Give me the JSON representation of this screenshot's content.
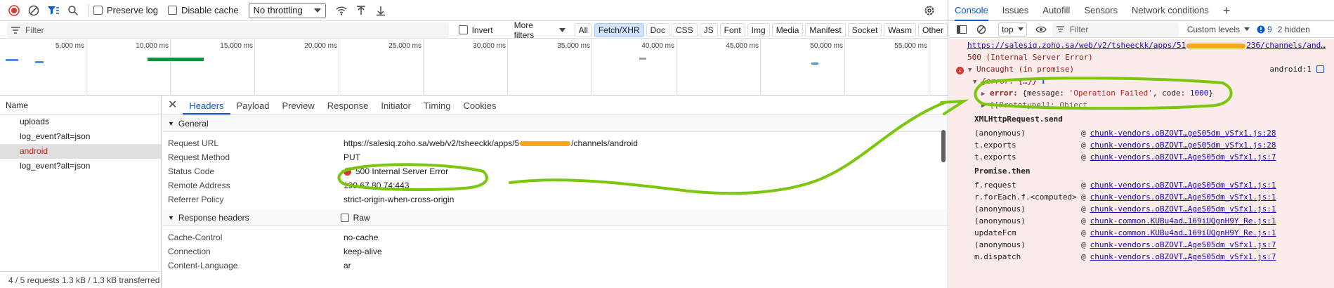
{
  "network": {
    "toolbar": {
      "preserve_log": "Preserve log",
      "disable_cache": "Disable cache",
      "throttling": "No throttling"
    },
    "filterbar": {
      "placeholder": "Filter",
      "invert": "Invert",
      "more_filters": "More filters",
      "types": [
        "All",
        "Fetch/XHR",
        "Doc",
        "CSS",
        "JS",
        "Font",
        "Img",
        "Media",
        "Manifest",
        "Socket",
        "Wasm",
        "Other"
      ],
      "active_type": "Fetch/XHR"
    },
    "overview": {
      "ticks": [
        "5,000 ms",
        "10,000 ms",
        "15,000 ms",
        "20,000 ms",
        "25,000 ms",
        "30,000 ms",
        "35,000 ms",
        "40,000 ms",
        "45,000 ms",
        "50,000 ms",
        "55,000 ms"
      ]
    },
    "requests": {
      "header": "Name",
      "items": [
        "uploads",
        "log_event?alt=json",
        "android",
        "log_event?alt=json"
      ],
      "selected": "android"
    },
    "status": "4 / 5 requests   1.3 kB / 1.3 kB transferred",
    "details": {
      "tabs": [
        "Headers",
        "Payload",
        "Preview",
        "Response",
        "Initiator",
        "Timing",
        "Cookies"
      ],
      "general": {
        "title": "General",
        "request_url_key": "Request URL",
        "request_url_a": "https://salesiq.zoho.sa/web/v2/tsheeckk/apps/5",
        "request_url_b": "/channels/android",
        "method_key": "Request Method",
        "method_val": "PUT",
        "status_key": "Status Code",
        "status_val": "500 Internal Server Error",
        "remote_key": "Remote Address",
        "remote_val": "199.67.80.74:443",
        "referrer_key": "Referrer Policy",
        "referrer_val": "strict-origin-when-cross-origin"
      },
      "response": {
        "title": "Response headers",
        "raw": "Raw",
        "rows": [
          {
            "key": "Cache-Control",
            "val": "no-cache"
          },
          {
            "key": "Connection",
            "val": "keep-alive"
          },
          {
            "key": "Content-Language",
            "val": "ar"
          }
        ]
      }
    }
  },
  "console": {
    "tabs": [
      "Console",
      "Issues",
      "Autofill",
      "Sensors",
      "Network conditions"
    ],
    "context": "top",
    "filter_placeholder": "Filter",
    "levels": "Custom levels",
    "issues_count": "9",
    "hidden": "2 hidden",
    "lines": {
      "url_a": "https://salesiq.zoho.sa/web/v2/tsheeckk/apps/51",
      "url_b": "236/channels/and…",
      "http_status": "500 (Internal Server Error)",
      "uncaught": "Uncaught (in promise)",
      "uncaught_src": "android:1",
      "obj_open": "{error: {…}}",
      "error_key": "error:",
      "error_msg": "'Operation Failed'",
      "error_code": "1000",
      "proto": "[[Prototype]]: Object",
      "xhr_send": "XMLHttpRequest.send",
      "promise_then": "Promise.then"
    },
    "stack1": [
      {
        "fn": "(anonymous)",
        "src": "chunk-vendors.oBZOVT…geS05dm_vSfx1.js:28"
      },
      {
        "fn": "t.exports",
        "src": "chunk-vendors.oBZOVT…geS05dm_vSfx1.js:28"
      },
      {
        "fn": "t.exports",
        "src": "chunk-vendors.oBZOVT…AgeS05dm_vSfx1.js:7"
      }
    ],
    "stack2": [
      {
        "fn": "f.request",
        "src": "chunk-vendors.oBZOVT…AgeS05dm_vSfx1.js:1"
      },
      {
        "fn": "r.forEach.f.<computed>",
        "src": "chunk-vendors.oBZOVT…AgeS05dm_vSfx1.js:1"
      },
      {
        "fn": "(anonymous)",
        "src": "chunk-vendors.oBZOVT…AgeS05dm_vSfx1.js:1"
      },
      {
        "fn": "(anonymous)",
        "src": "chunk-common.KUBu4ad…169iUQgnH9Y_Re.js:1"
      },
      {
        "fn": "updateFcm",
        "src": "chunk-common.KUBu4ad…169iUQgnH9Y_Re.js:1"
      },
      {
        "fn": "(anonymous)",
        "src": "chunk-vendors.oBZOVT…AgeS05dm_vSfx1.js:7"
      },
      {
        "fn": "m.dispatch",
        "src": "chunk-vendors.oBZOVT…AgeS05dm_vSfx1.js:7"
      }
    ]
  }
}
